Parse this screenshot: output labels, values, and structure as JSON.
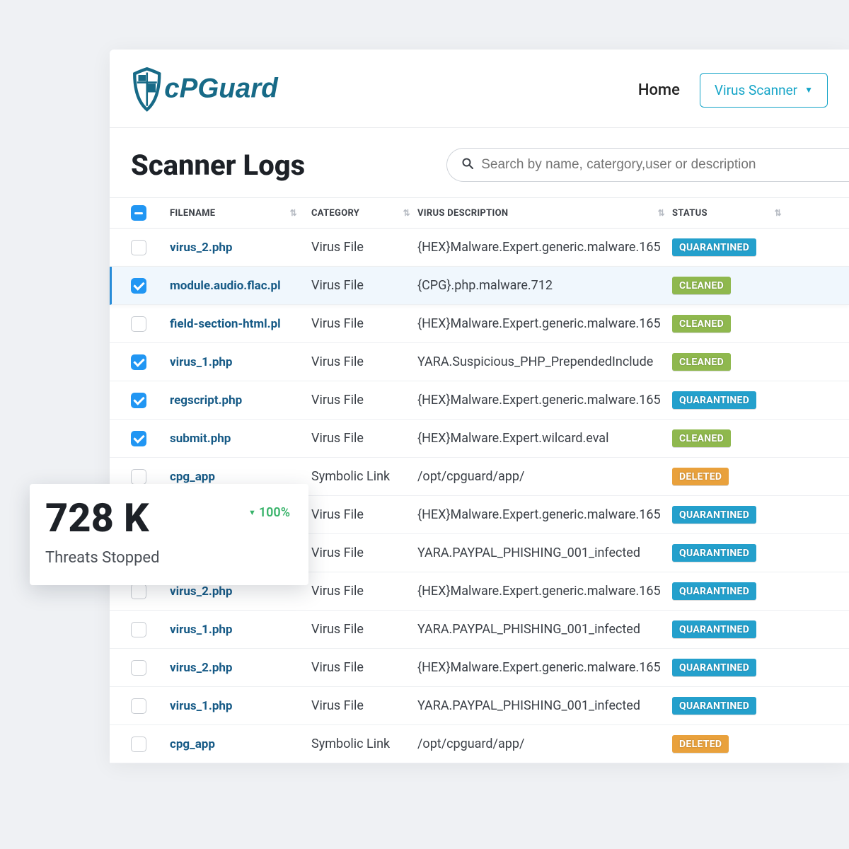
{
  "brand": {
    "name": "cPGuard"
  },
  "nav": {
    "home": "Home",
    "dropdown_label": "Virus Scanner"
  },
  "page": {
    "title": "Scanner Logs",
    "search_placeholder": "Search by name, catergory,user or description"
  },
  "table": {
    "headers": {
      "filename": "FILENAME",
      "category": "CATEGORY",
      "description": "VIRUS DESCRIPTION",
      "status": "STATUS"
    },
    "rows": [
      {
        "checked": false,
        "highlight": false,
        "filename": "virus_2.php",
        "category": "Virus File",
        "description": "{HEX}Malware.Expert.generic.malware.165",
        "status": "QUARANTINED"
      },
      {
        "checked": true,
        "highlight": true,
        "filename": "module.audio.flac.pl",
        "category": "Virus File",
        "description": "{CPG}.php.malware.712",
        "status": "CLEANED"
      },
      {
        "checked": false,
        "highlight": false,
        "filename": "field-section-html.pl",
        "category": "Virus File",
        "description": "{HEX}Malware.Expert.generic.malware.165",
        "status": "CLEANED"
      },
      {
        "checked": true,
        "highlight": false,
        "filename": "virus_1.php",
        "category": "Virus File",
        "description": "YARA.Suspicious_PHP_PrependedInclude",
        "status": "CLEANED"
      },
      {
        "checked": true,
        "highlight": false,
        "filename": "regscript.php",
        "category": "Virus File",
        "description": "{HEX}Malware.Expert.generic.malware.165",
        "status": "QUARANTINED"
      },
      {
        "checked": true,
        "highlight": false,
        "filename": "submit.php",
        "category": "Virus File",
        "description": "{HEX}Malware.Expert.wilcard.eval",
        "status": "CLEANED"
      },
      {
        "checked": false,
        "highlight": false,
        "filename": "cpg_app",
        "category": "Symbolic Link",
        "description": "/opt/cpguard/app/",
        "status": "DELETED"
      },
      {
        "checked": false,
        "highlight": false,
        "filename": "",
        "category": "Virus File",
        "description": "{HEX}Malware.Expert.generic.malware.165",
        "status": "QUARANTINED"
      },
      {
        "checked": false,
        "highlight": false,
        "filename": "",
        "category": "Virus File",
        "description": "YARA.PAYPAL_PHISHING_001_infected",
        "status": "QUARANTINED"
      },
      {
        "checked": false,
        "highlight": false,
        "filename": "virus_2.php",
        "category": "Virus File",
        "description": "{HEX}Malware.Expert.generic.malware.165",
        "status": "QUARANTINED"
      },
      {
        "checked": false,
        "highlight": false,
        "filename": "virus_1.php",
        "category": "Virus File",
        "description": "YARA.PAYPAL_PHISHING_001_infected",
        "status": "QUARANTINED"
      },
      {
        "checked": false,
        "highlight": false,
        "filename": "virus_2.php",
        "category": "Virus File",
        "description": "{HEX}Malware.Expert.generic.malware.165",
        "status": "QUARANTINED"
      },
      {
        "checked": false,
        "highlight": false,
        "filename": "virus_1.php",
        "category": "Virus File",
        "description": "YARA.PAYPAL_PHISHING_001_infected",
        "status": "QUARANTINED"
      },
      {
        "checked": false,
        "highlight": false,
        "filename": "cpg_app",
        "category": "Symbolic Link",
        "description": "/opt/cpguard/app/",
        "status": "DELETED"
      }
    ]
  },
  "stat_card": {
    "value": "728 K",
    "percent": "100%",
    "label": "Threats Stopped"
  }
}
